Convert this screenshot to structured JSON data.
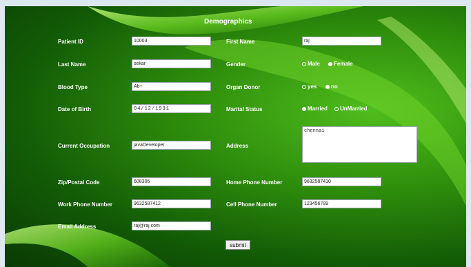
{
  "form": {
    "title": "Demographics",
    "patient_id": {
      "label": "Patient ID",
      "value": "10003"
    },
    "first_name": {
      "label": "First Name",
      "value": "raj"
    },
    "last_name": {
      "label": "Last Name",
      "value": "sekar"
    },
    "gender": {
      "label": "Gender",
      "options": [
        "Male",
        "Female"
      ],
      "selected": "Female"
    },
    "blood_type": {
      "label": "Blood Type",
      "value": "Ab+"
    },
    "organ_donor": {
      "label": "Organ Donor",
      "options": [
        "yes",
        "no"
      ],
      "selected": "no"
    },
    "dob": {
      "label": "Date of Birth",
      "value": "04/12/1991"
    },
    "marital_status": {
      "label": "Marital Status",
      "options": [
        "Married",
        "UnMarried"
      ],
      "selected": "Married"
    },
    "occupation": {
      "label": "Current Occupation",
      "value": "javaDeveloper"
    },
    "address": {
      "label": "Address",
      "value": "chennai"
    },
    "zip": {
      "label": "Zip/Postal Code",
      "value": "608305"
    },
    "home_phone": {
      "label": "Home Phone Number",
      "value": "9632587410"
    },
    "work_phone": {
      "label": "Work Phone Number",
      "value": "9632587412"
    },
    "cell_phone": {
      "label": "Cell Phone Number",
      "value": "123456789"
    },
    "email": {
      "label": "Email Address",
      "value": "raj@raj.com"
    },
    "submit_label": "submit"
  },
  "colors": {
    "background_green": "#2f8f0c",
    "label_text": "#ffffff"
  }
}
